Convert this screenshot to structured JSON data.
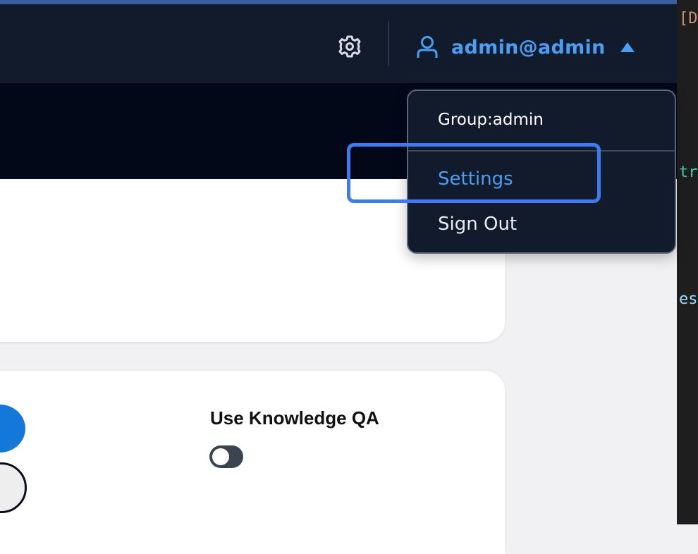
{
  "header": {
    "user_email": "admin@admin",
    "icons": {
      "settings": "gear-icon",
      "user": "user-icon",
      "caret": "caret-up-icon"
    }
  },
  "user_menu": {
    "group_label": "Group:admin",
    "items": [
      {
        "label": "Settings",
        "state": "highlighted"
      },
      {
        "label": "Sign Out"
      }
    ]
  },
  "settings_card": {
    "knowledge_qa_label": "Use Knowledge QA",
    "knowledge_qa_enabled": false
  },
  "editor_fragments": [
    "[D",
    "tr",
    "es"
  ],
  "colors": {
    "header_bg": "#111b2b",
    "accent": "#4a9ff5",
    "highlight_box": "#3f7bf0",
    "banner_bg": "#020817",
    "primary_button": "#1478db"
  }
}
